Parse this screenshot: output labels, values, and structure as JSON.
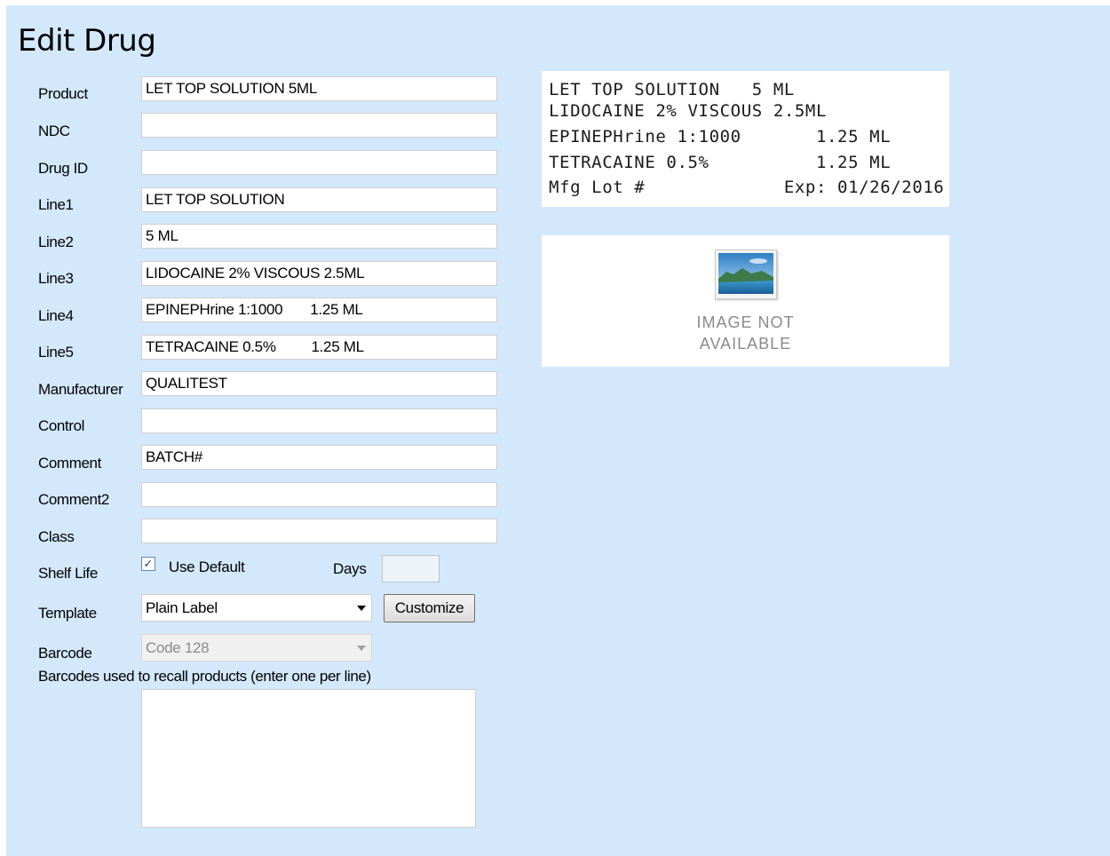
{
  "title": "Edit Drug",
  "fields": [
    {
      "label": "Product",
      "value": "LET TOP SOLUTION 5ML"
    },
    {
      "label": "NDC",
      "value": ""
    },
    {
      "label": "Drug ID",
      "value": ""
    },
    {
      "label": "Line1",
      "value": "LET TOP SOLUTION"
    },
    {
      "label": "Line2",
      "value": "5 ML"
    },
    {
      "label": "Line3",
      "value": "LIDOCAINE 2% VISCOUS 2.5ML"
    },
    {
      "label": "Line4",
      "value": "EPINEPHrine 1:1000       1.25 ML"
    },
    {
      "label": "Line5",
      "value": "TETRACAINE 0.5%         1.25 ML"
    },
    {
      "label": "Manufacturer",
      "value": "QUALITEST"
    },
    {
      "label": "Control",
      "value": ""
    },
    {
      "label": "Comment",
      "value": "BATCH#"
    },
    {
      "label": "Comment2",
      "value": ""
    },
    {
      "label": "Class",
      "value": ""
    }
  ],
  "shelf_life": {
    "label": "Shelf Life",
    "checkbox_label": "Use Default",
    "checked": true,
    "check_glyph": "✓",
    "days_label": "Days",
    "days_value": ""
  },
  "template": {
    "label": "Template",
    "value": "Plain Label",
    "button": "Customize"
  },
  "barcode": {
    "label": "Barcode",
    "value": "Code 128"
  },
  "recall": {
    "label": "Barcodes used to recall products (enter one per line)",
    "value": ""
  },
  "preview": {
    "line1": "LET TOP SOLUTION   5 ML",
    "line2": "LIDOCAINE 2% VISCOUS 2.5ML",
    "line3": "EPINEPHrine 1:1000       1.25 ML",
    "line4": "TETRACAINE 0.5%          1.25 ML",
    "line5": "Mfg Lot #             Exp: 01/26/2016"
  },
  "image_placeholder": {
    "line1": "IMAGE NOT",
    "line2": "AVAILABLE"
  },
  "colors": {
    "panel": "#d4e8fb",
    "field_border": "#cfcfcf"
  }
}
